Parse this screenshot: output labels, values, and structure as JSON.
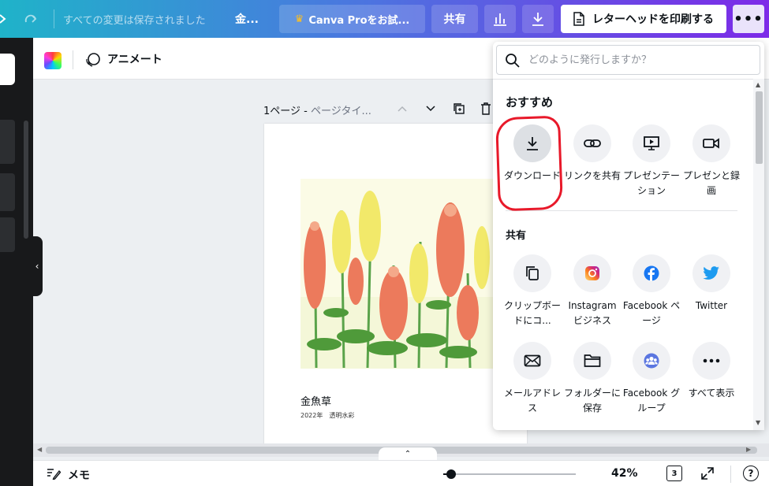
{
  "topbar": {
    "saved_status": "すべての変更は保存されました",
    "title": "金...",
    "pro_label": "Canva Proをお試...",
    "share_label": "共有",
    "print_label": "レターヘッドを印刷する",
    "more_label": "•••"
  },
  "toolbar": {
    "animate_label": "アニメート"
  },
  "canvas": {
    "page_label": "1ページ - ",
    "page_title_placeholder": "ページタイ...",
    "caption_title": "金魚草",
    "caption_sub": "2022年　透明水彩"
  },
  "bottombar": {
    "notes_label": "メモ",
    "zoom": "42%",
    "page_count": "3",
    "help": "?"
  },
  "publish_menu": {
    "search_placeholder": "どのように発行しますか？",
    "recommended_title": "おすすめ",
    "share_title": "共有",
    "recommended": [
      {
        "label": "ダウンロード",
        "icon": "download-icon"
      },
      {
        "label": "リンクを共有",
        "icon": "link-icon"
      },
      {
        "label": "プレゼンテーション",
        "icon": "present-icon"
      },
      {
        "label": "プレゼンと録画",
        "icon": "record-icon"
      }
    ],
    "share": [
      {
        "label": "クリップボードにコ...",
        "icon": "copy-icon"
      },
      {
        "label": "Instagram ビジネス",
        "icon": "instagram-icon"
      },
      {
        "label": "Facebook ページ",
        "icon": "facebook-icon"
      },
      {
        "label": "Twitter",
        "icon": "twitter-icon"
      },
      {
        "label": "メールアドレス",
        "icon": "mail-icon"
      },
      {
        "label": "フォルダーに保存",
        "icon": "folder-icon"
      },
      {
        "label": "Facebook グループ",
        "icon": "facebook-group-icon"
      },
      {
        "label": "すべて表示",
        "icon": "more-icon"
      }
    ]
  },
  "colors": {
    "brand_gradient_start": "#1fb3c9",
    "brand_gradient_end": "#7d2ae8",
    "highlight_red": "#e8192a",
    "facebook_blue": "#1877f2",
    "twitter_blue": "#1d9bf0"
  }
}
